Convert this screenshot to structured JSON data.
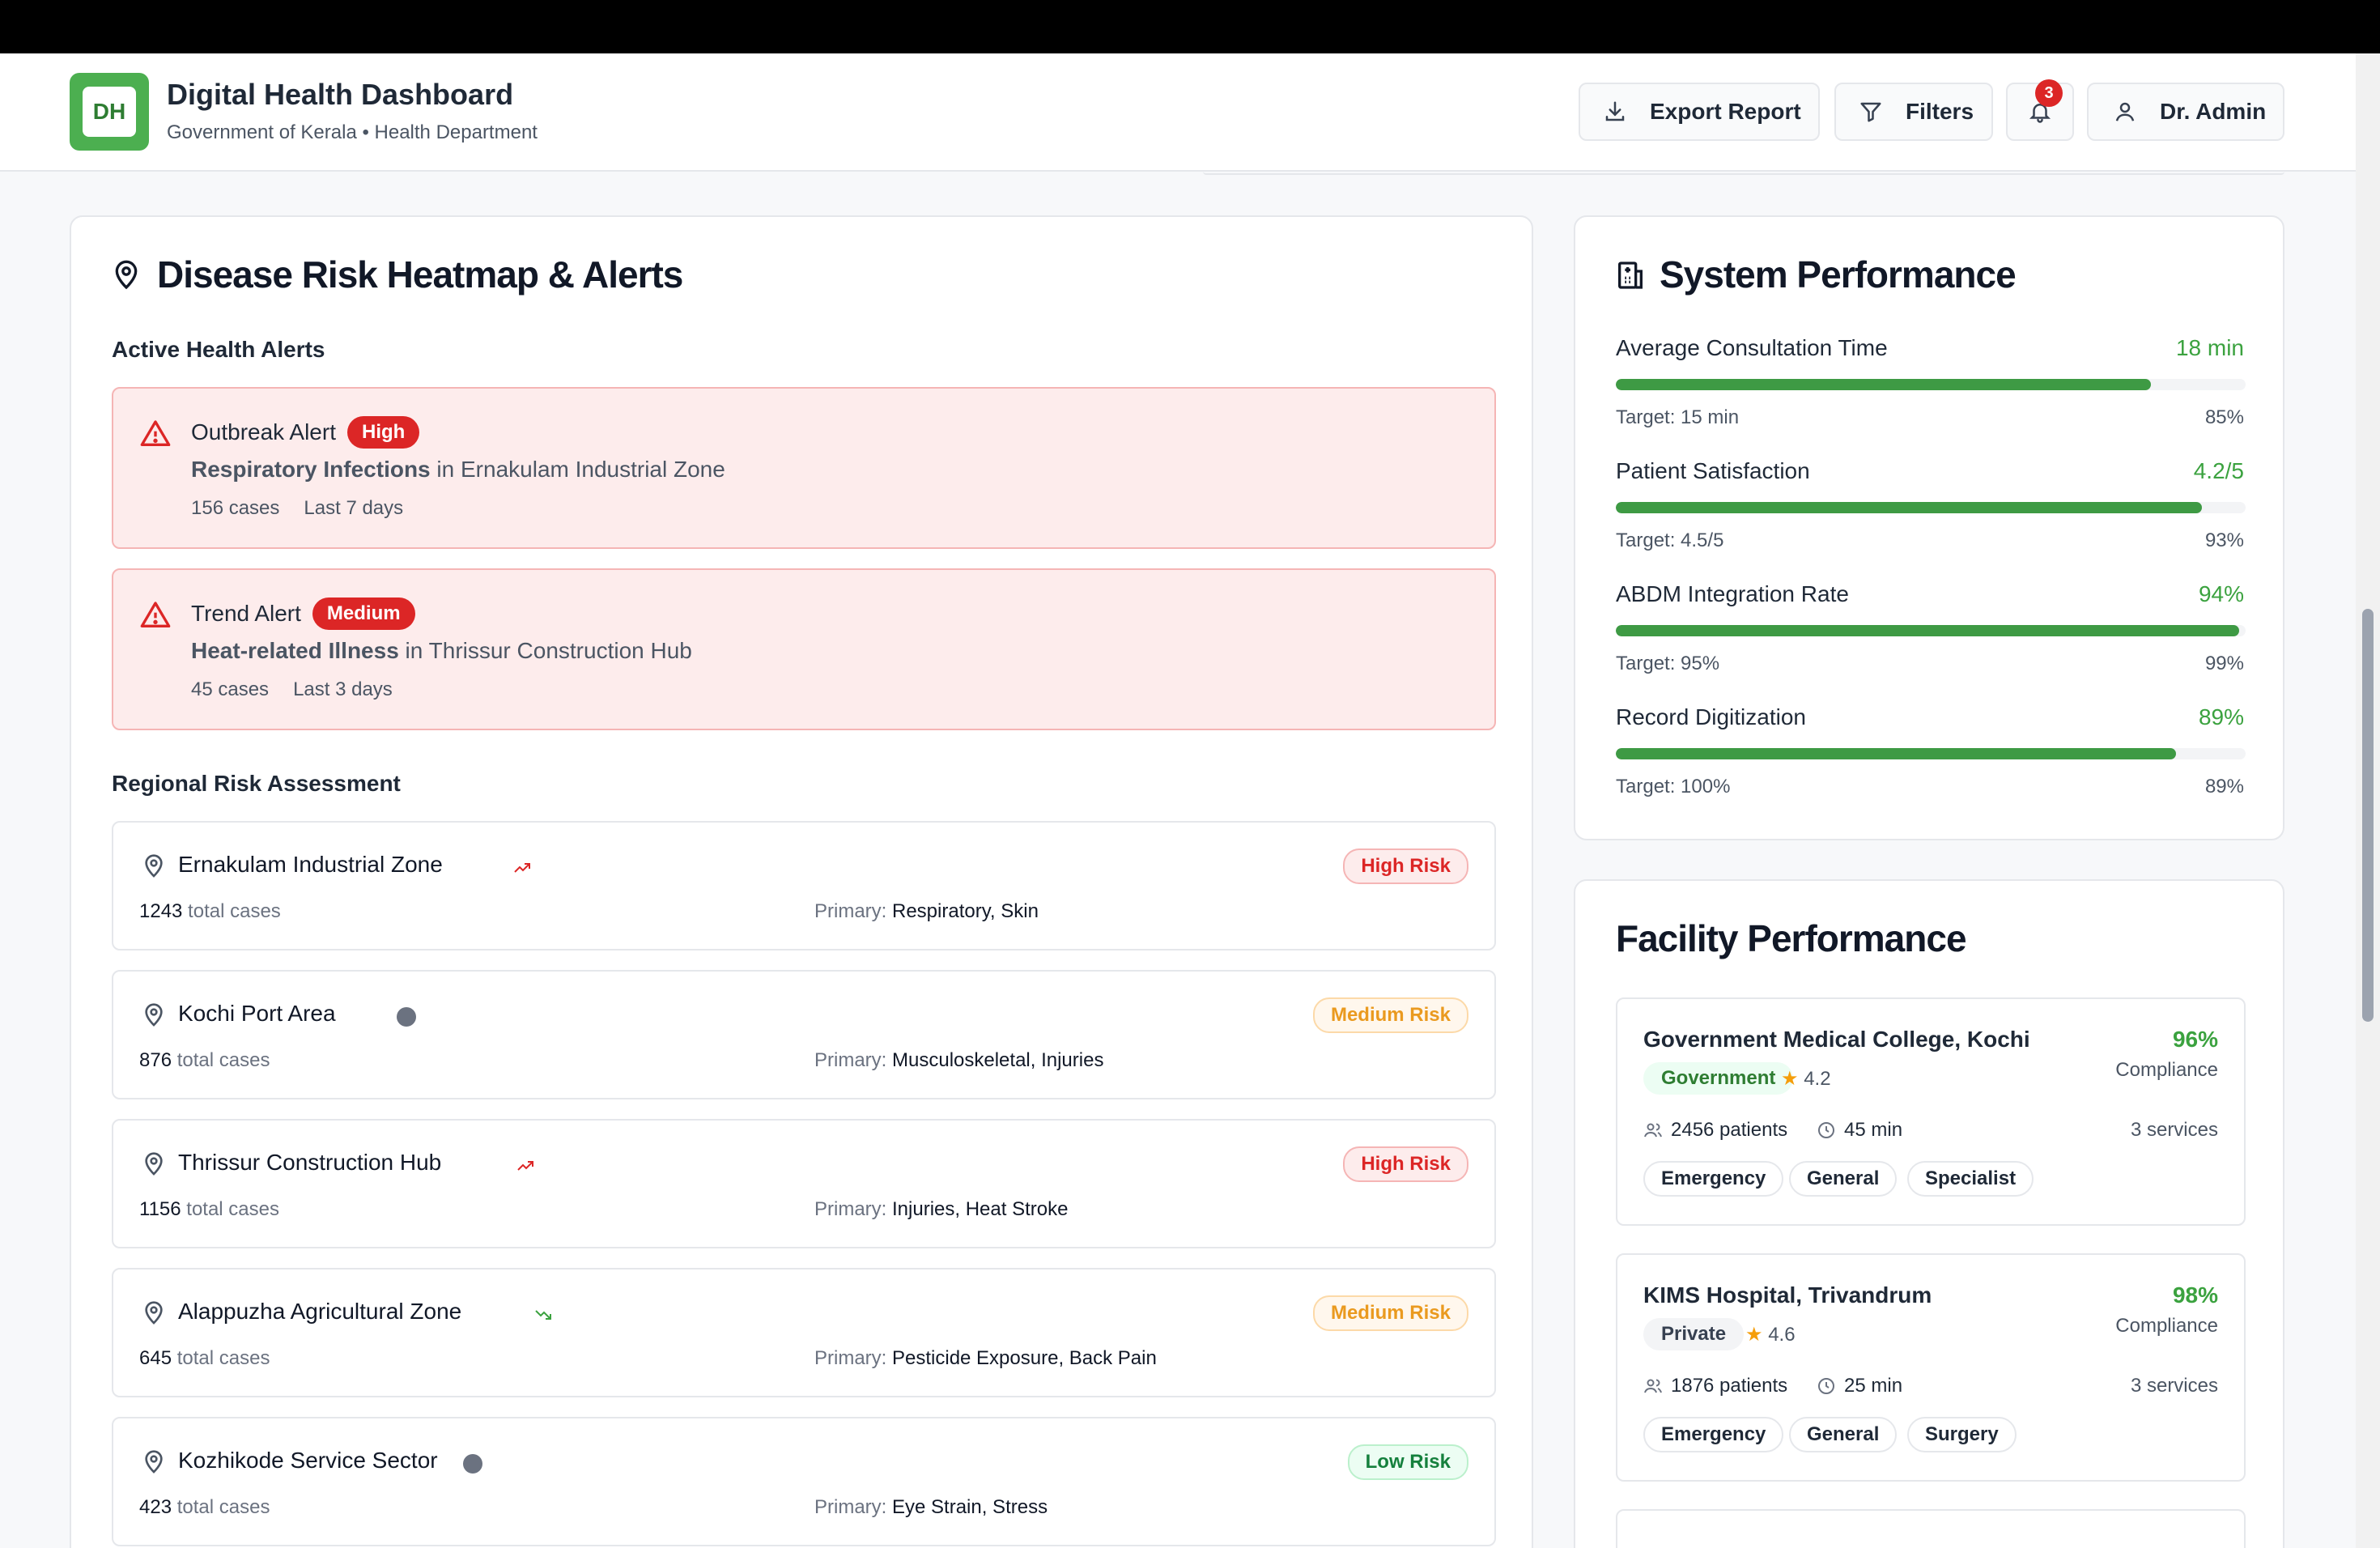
{
  "header": {
    "logo_text": "DH",
    "title": "Digital Health Dashboard",
    "subtitle": "Government of Kerala • Health Department",
    "export_label": "Export Report",
    "filters_label": "Filters",
    "notification_count": "3",
    "user_label": "Dr. Admin"
  },
  "heatmap": {
    "title": "Disease Risk Heatmap & Alerts",
    "alerts_heading": "Active Health Alerts",
    "alerts": [
      {
        "type": "Outbreak Alert",
        "severity": "High",
        "disease": "Respiratory Infections",
        "in": " in ",
        "location": "Ernakulam Industrial Zone",
        "cases": "156 cases",
        "period": "Last 7 days"
      },
      {
        "type": "Trend Alert",
        "severity": "Medium",
        "disease": "Heat-related Illness",
        "in": " in ",
        "location": "Thrissur Construction Hub",
        "cases": "45 cases",
        "period": "Last 3 days"
      }
    ],
    "regional_heading": "Regional Risk Assessment",
    "total_cases_suffix": " total cases",
    "primary_prefix": "Primary: ",
    "regions": [
      {
        "name": "Ernakulam Industrial Zone",
        "trend": "up",
        "cases": "1243",
        "primary": "Respiratory, Skin",
        "risk": "High Risk"
      },
      {
        "name": "Kochi Port Area",
        "trend": "stable",
        "cases": "876",
        "primary": "Musculoskeletal, Injuries",
        "risk": "Medium Risk"
      },
      {
        "name": "Thrissur Construction Hub",
        "trend": "up",
        "cases": "1156",
        "primary": "Injuries, Heat Stroke",
        "risk": "High Risk"
      },
      {
        "name": "Alappuzha Agricultural Zone",
        "trend": "down",
        "cases": "645",
        "primary": "Pesticide Exposure, Back Pain",
        "risk": "Medium Risk"
      },
      {
        "name": "Kozhikode Service Sector",
        "trend": "stable",
        "cases": "423",
        "primary": "Eye Strain, Stress",
        "risk": "Low Risk"
      }
    ]
  },
  "system_performance": {
    "title": "System Performance",
    "metrics": [
      {
        "label": "Average Consultation Time",
        "value": "18 min",
        "target": "Target: 15 min",
        "pct": "85%",
        "fill": 0.85
      },
      {
        "label": "Patient Satisfaction",
        "value": "4.2/5",
        "target": "Target: 4.5/5",
        "pct": "93%",
        "fill": 0.93
      },
      {
        "label": "ABDM Integration Rate",
        "value": "94%",
        "target": "Target: 95%",
        "pct": "99%",
        "fill": 0.99
      },
      {
        "label": "Record Digitization",
        "value": "89%",
        "target": "Target: 100%",
        "pct": "89%",
        "fill": 0.89
      }
    ]
  },
  "facility_performance": {
    "title": "Facility Performance",
    "compliance_label": "Compliance",
    "facilities": [
      {
        "name": "Government Medical College, Kochi",
        "compliance": "96%",
        "type": "Government",
        "rating": "4.2",
        "patients": "2456 patients",
        "wait": "45 min",
        "services_count": "3 services",
        "services": [
          "Emergency",
          "General",
          "Specialist"
        ]
      },
      {
        "name": "KIMS Hospital, Trivandrum",
        "compliance": "98%",
        "type": "Private",
        "rating": "4.6",
        "patients": "1876 patients",
        "wait": "25 min",
        "services_count": "3 services",
        "services": [
          "Emergency",
          "General",
          "Surgery"
        ]
      }
    ]
  },
  "colors": {
    "accent": "#3ba23f",
    "danger": "#dc2626",
    "warning": "#ea9a1f"
  }
}
